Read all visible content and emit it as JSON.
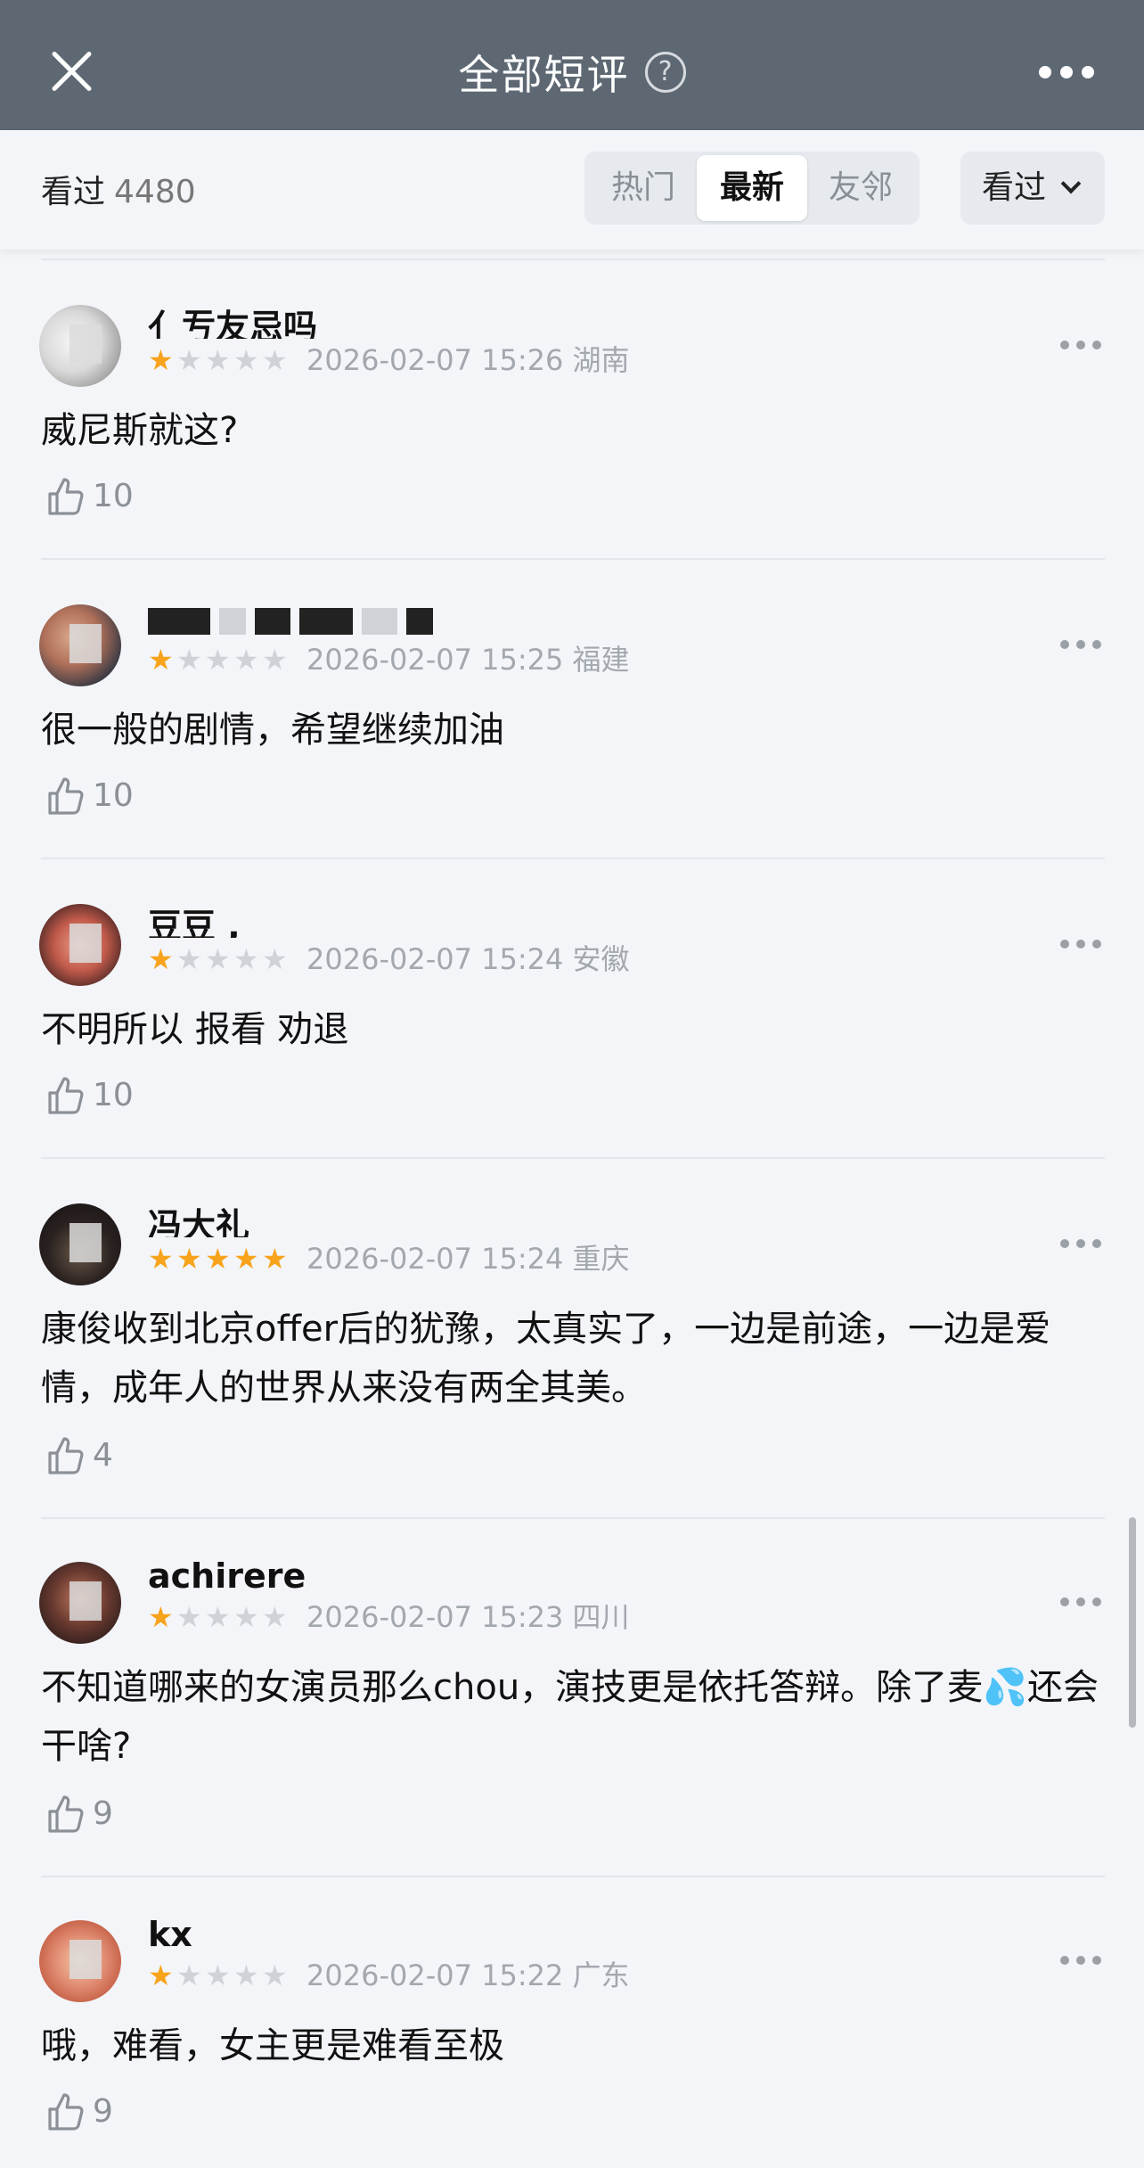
{
  "header": {
    "title": "全部短评",
    "help_icon": "?",
    "close_icon": "close-icon",
    "more_icon": "more-icon"
  },
  "filter": {
    "watched_label": "看过",
    "watched_count": "4480",
    "tabs": [
      "热门",
      "最新",
      "友邻"
    ],
    "active_tab": "最新",
    "dropdown_label": "看过"
  },
  "colors": {
    "topbar": "#5d6873",
    "star_on": "#f7a31b",
    "star_off": "#cfd2d6"
  },
  "reviews": [
    {
      "name": "亻亐友忌吗",
      "rating": 1,
      "date": "2026-02-07 15:26",
      "region": "湖南",
      "content": "威尼斯就这?",
      "likes": "10"
    },
    {
      "name": "",
      "rating": 1,
      "date": "2026-02-07 15:25",
      "region": "福建",
      "content": "很一般的剧情，希望继续加油",
      "likes": "10"
    },
    {
      "name": "豆豆 ,",
      "rating": 1,
      "date": "2026-02-07 15:24",
      "region": "安徽",
      "content": "不明所以 报看 劝退",
      "likes": "10"
    },
    {
      "name": "冯大礼",
      "rating": 5,
      "date": "2026-02-07 15:24",
      "region": "重庆",
      "content": "康俊收到北京offer后的犹豫，太真实了，一边是前途，一边是爱情，成年人的世界从来没有两全其美。",
      "likes": "4"
    },
    {
      "name": "achirere",
      "rating": 1,
      "date": "2026-02-07 15:23",
      "region": "四川",
      "content": "不知道哪来的女演员那么chou，演技更是依托答辩。除了麦💦还会干啥?",
      "likes": "9"
    },
    {
      "name": "kx",
      "rating": 1,
      "date": "2026-02-07 15:22",
      "region": "广东",
      "content": "哦，难看，女主更是难看至极",
      "likes": "9"
    }
  ]
}
